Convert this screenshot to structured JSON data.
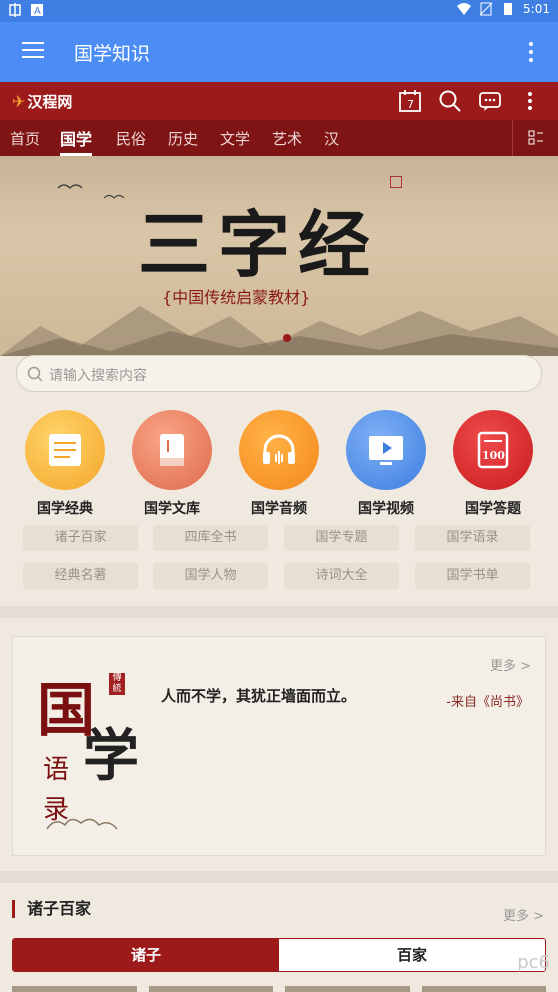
{
  "status": {
    "time": "5:01"
  },
  "appbar": {
    "title": "国学知识"
  },
  "site": {
    "logo": "汉程网",
    "calendar_day": "7",
    "tabs": [
      "首页",
      "国学",
      "民俗",
      "历史",
      "文学",
      "艺术",
      "汉"
    ],
    "active_tab": "国学"
  },
  "banner": {
    "calligraphy": "三字经",
    "subtitle": "{中国传统启蒙教材}"
  },
  "search": {
    "placeholder": "请输入搜索内容"
  },
  "categories": [
    {
      "label": "国学经典",
      "color": "#f6b73c"
    },
    {
      "label": "国学文库",
      "color": "#ea7a5c"
    },
    {
      "label": "国学音频",
      "color": "#f5921e"
    },
    {
      "label": "国学视频",
      "color": "#4d8ee8"
    },
    {
      "label": "国学答题",
      "color": "#d8262a"
    }
  ],
  "chips": [
    "诸子百家",
    "四库全书",
    "国学专题",
    "国学语录",
    "经典名著",
    "国学人物",
    "诗词大全",
    "国学书单"
  ],
  "quote": {
    "more": "更多 >",
    "text": "人而不学，其犹正墙面而立。",
    "source": "-来自《尚书》",
    "art_char1": "国",
    "art_char2": "学",
    "art_v1": "语",
    "art_v2": "录",
    "stamp": "傳統"
  },
  "section": {
    "title": "诸子百家",
    "more": "更多 >",
    "segments": [
      "诸子",
      "百家"
    ]
  },
  "watermark": "pc6"
}
